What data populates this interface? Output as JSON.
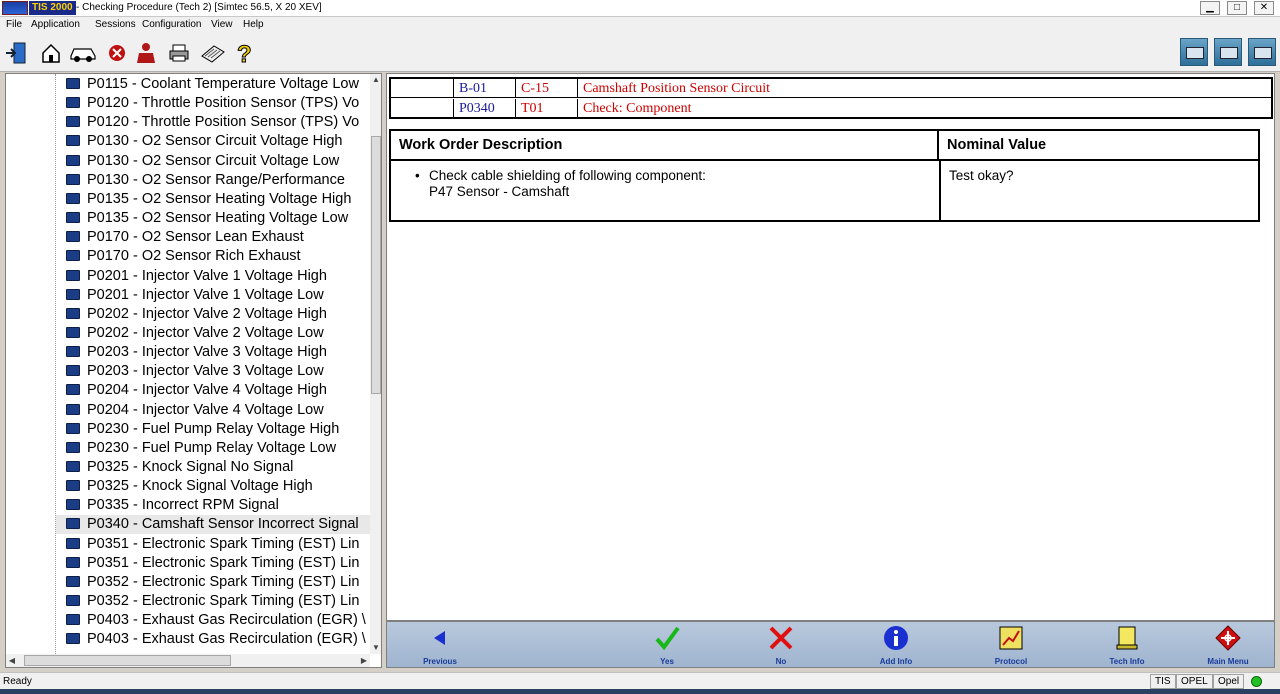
{
  "window": {
    "app_name": "TIS 2000",
    "caption": "- Checking Procedure (Tech 2) [Simtec 56.5, X 20 XEV]",
    "minimize": "▁",
    "maximize": "□",
    "close": "✕"
  },
  "menu": [
    "File",
    "Application",
    "Sessions",
    "Configuration",
    "View",
    "Help"
  ],
  "toolbar_icons": [
    "exit-icon",
    "home-icon",
    "vehicle-icon",
    "stop-icon",
    "person-icon",
    "printer-icon",
    "book-icon",
    "help-icon"
  ],
  "tree": {
    "items": [
      "P0115 - Coolant Temperature Voltage Low",
      "P0120 - Throttle Position Sensor (TPS) Vo",
      "P0120 - Throttle Position Sensor (TPS) Vo",
      "P0130 - O2 Sensor Circuit Voltage High",
      "P0130 - O2 Sensor Circuit Voltage Low",
      "P0130 - O2 Sensor Range/Performance",
      "P0135 - O2 Sensor Heating Voltage High",
      "P0135 - O2 Sensor Heating Voltage Low",
      "P0170 - O2 Sensor Lean Exhaust",
      "P0170 - O2 Sensor Rich Exhaust",
      "P0201 - Injector Valve 1 Voltage High",
      "P0201 - Injector Valve 1 Voltage Low",
      "P0202 - Injector Valve 2 Voltage High",
      "P0202 - Injector Valve 2 Voltage Low",
      "P0203 - Injector Valve 3 Voltage High",
      "P0203 - Injector Valve 3 Voltage Low",
      "P0204 - Injector Valve 4 Voltage High",
      "P0204 - Injector Valve 4 Voltage Low",
      "P0230 - Fuel Pump Relay Voltage High",
      "P0230 - Fuel Pump Relay Voltage Low",
      "P0325 - Knock Signal No Signal",
      "P0325 - Knock Signal Voltage High",
      "P0335 - Incorrect RPM Signal",
      "P0340 - Camshaft Sensor Incorrect Signal",
      "P0351 - Electronic Spark Timing (EST) Lin",
      "P0351 - Electronic Spark Timing (EST) Lin",
      "P0352 - Electronic Spark Timing (EST) Lin",
      "P0352 - Electronic Spark Timing (EST) Lin",
      "P0403 - Exhaust Gas Recirculation (EGR) \\",
      "P0403 - Exhaust Gas Recirculation (EGR) \\"
    ],
    "selected_index": 23,
    "scroll_up": "▲",
    "scroll_down": "▼",
    "scroll_left": "◀",
    "scroll_right": "▶"
  },
  "header_table": {
    "row1": [
      "",
      "B-01",
      "C-15",
      "Camshaft Position Sensor Circuit"
    ],
    "row2": [
      "",
      "P0340",
      "T01",
      "Check: Component"
    ]
  },
  "work_table": {
    "col1_header": "Work Order Description",
    "col2_header": "Nominal Value",
    "bullet": "•",
    "description_line1": "Check cable shielding of following component:",
    "description_line2": "P47 Sensor - Camshaft",
    "nominal": "Test okay?"
  },
  "bottom_buttons": [
    {
      "label": "Previous",
      "icon": "previous-arrow-icon"
    },
    {
      "label": "Yes",
      "icon": "checkmark-icon"
    },
    {
      "label": "No",
      "icon": "cross-icon"
    },
    {
      "label": "Add Info",
      "icon": "info-icon"
    },
    {
      "label": "Protocol",
      "icon": "protocol-icon"
    },
    {
      "label": "Tech Info",
      "icon": "tech-info-icon"
    },
    {
      "label": "Main Menu",
      "icon": "main-menu-icon"
    }
  ],
  "status": {
    "left": "Ready",
    "fields": [
      "TIS",
      "OPEL",
      "Opel"
    ]
  },
  "colors": {
    "header_code": "#1a1a9a",
    "header_red": "#cc0000",
    "button_label": "#1a3a9a",
    "bottom_bar": "#a8bbd4"
  }
}
